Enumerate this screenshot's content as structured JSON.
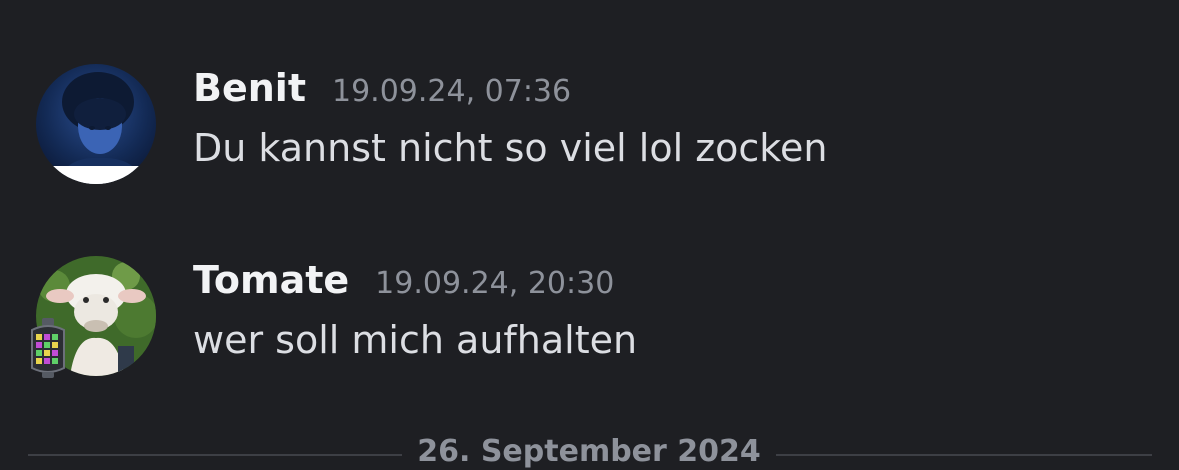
{
  "messages": [
    {
      "author": "Benit",
      "timestamp": "19.09.24, 07:36",
      "content": "Du kannst nicht so viel lol zocken",
      "avatar_icon": "dark-portrait-avatar"
    },
    {
      "author": "Tomate",
      "timestamp": "19.09.24, 20:30",
      "content": "wer soll mich aufhalten",
      "avatar_icon": "sheep-puppet-avatar",
      "avatar_decoration": "lantern-decoration-icon"
    }
  ],
  "date_divider": {
    "label": "26. September 2024"
  },
  "colors": {
    "background": "#1e1f23",
    "username": "#f2f3f5",
    "timestamp": "#8e929b",
    "message_text": "#dcdee3",
    "divider": "#3d3f45"
  }
}
